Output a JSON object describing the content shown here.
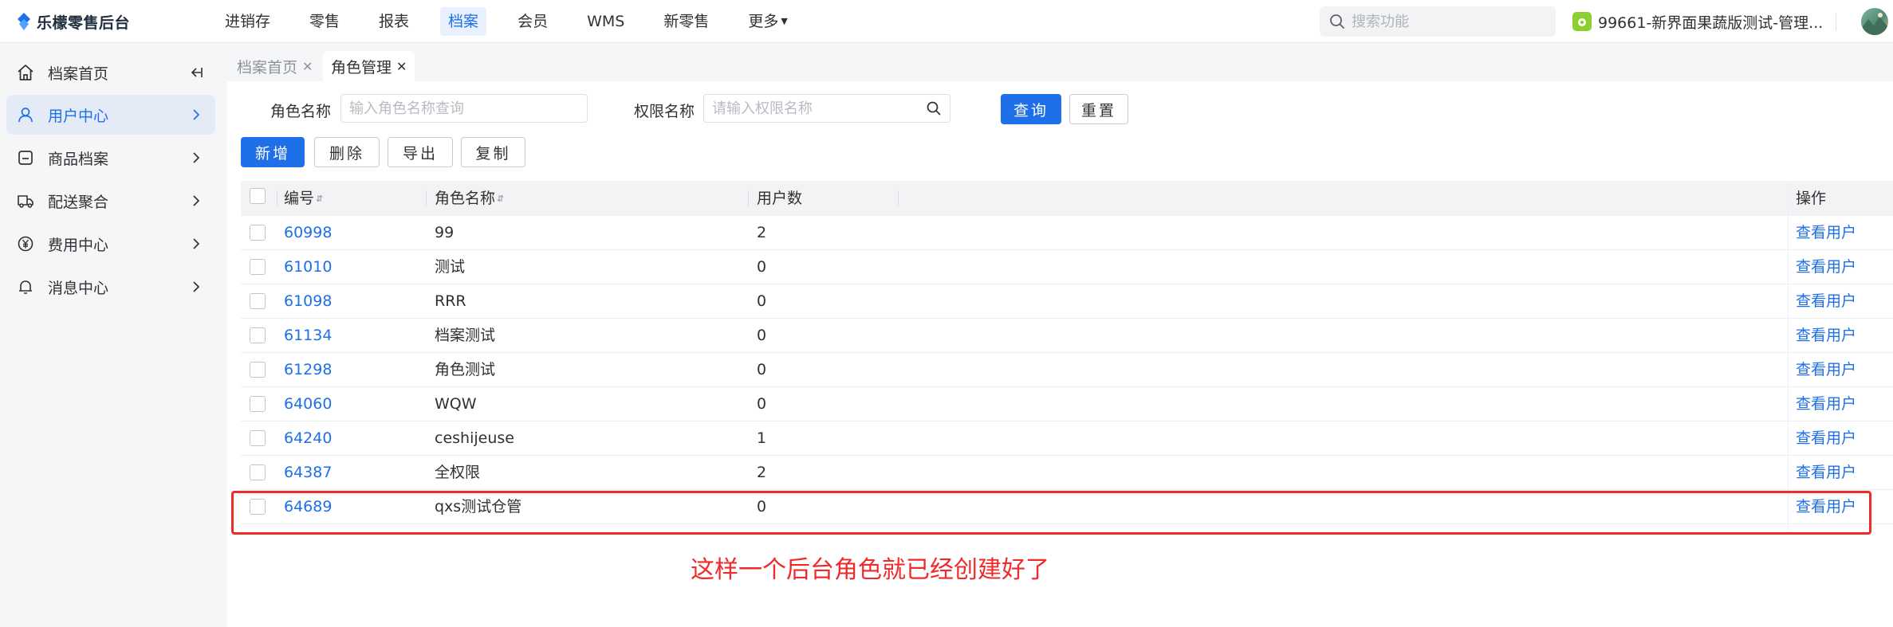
{
  "app": {
    "logo_text": "乐檬零售后台"
  },
  "topnav": {
    "items": [
      "进销存",
      "零售",
      "报表",
      "档案",
      "会员",
      "WMS",
      "新零售",
      "更多"
    ],
    "active": "档案",
    "search_placeholder": "搜索功能",
    "store_name": "99661-新界面果蔬版测试-管理..."
  },
  "sidebar": {
    "items": [
      {
        "label": "档案首页",
        "icon": "home-icon"
      },
      {
        "label": "用户中心",
        "icon": "user-icon"
      },
      {
        "label": "商品档案",
        "icon": "box-icon"
      },
      {
        "label": "配送聚合",
        "icon": "truck-icon"
      },
      {
        "label": "费用中心",
        "icon": "yen-icon"
      },
      {
        "label": "消息中心",
        "icon": "bell-icon"
      }
    ],
    "active": "用户中心"
  },
  "tabs": [
    {
      "label": "档案首页",
      "active": false
    },
    {
      "label": "角色管理",
      "active": true
    }
  ],
  "filters": {
    "role_name_label": "角色名称",
    "role_name_placeholder": "输入角色名称查询",
    "perm_name_label": "权限名称",
    "perm_name_placeholder": "请输入权限名称",
    "query_button": "查询",
    "reset_button": "重置"
  },
  "toolbar": {
    "add": "新增",
    "delete": "删除",
    "export": "导出",
    "copy": "复制"
  },
  "table": {
    "headers": {
      "id": "编号",
      "name": "角色名称",
      "users": "用户数",
      "op": "操作"
    },
    "op_link": "查看用户",
    "rows": [
      {
        "id": "60998",
        "name": "99",
        "users": "2"
      },
      {
        "id": "61010",
        "name": "测试",
        "users": "0"
      },
      {
        "id": "61098",
        "name": "RRR",
        "users": "0"
      },
      {
        "id": "61134",
        "name": "档案测试",
        "users": "0"
      },
      {
        "id": "61298",
        "name": "角色测试",
        "users": "0"
      },
      {
        "id": "64060",
        "name": "WQW",
        "users": "0"
      },
      {
        "id": "64240",
        "name": "ceshijeuse",
        "users": "1"
      },
      {
        "id": "64387",
        "name": "全权限",
        "users": "2"
      },
      {
        "id": "64689",
        "name": "qxs测试仓管",
        "users": "0"
      }
    ]
  },
  "annotation": {
    "text": "这样一个后台角色就已经创建好了"
  },
  "colors": {
    "accent": "#1e6fe8",
    "annotation": "#ee2a2a",
    "sidebar_bg": "#f5f6f8"
  }
}
